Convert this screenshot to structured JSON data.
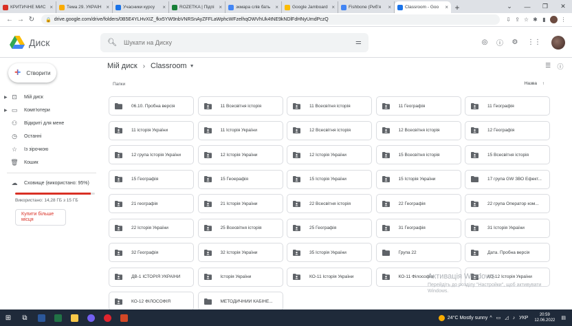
{
  "browser": {
    "tabs": [
      {
        "label": "КРИТИЧНЕ МИС",
        "color": "#d93025"
      },
      {
        "label": "Тема 29. УКРАЇН",
        "color": "#f9ab00"
      },
      {
        "label": "Учасники курсу",
        "color": "#1a73e8"
      },
      {
        "label": "ROZETKA | Підпі",
        "color": "#188038"
      },
      {
        "label": "зкмара слів бать",
        "color": "#4285f4"
      },
      {
        "label": "Google Jamboard",
        "color": "#fbbc04"
      },
      {
        "label": "Fishbone (Риб'я",
        "color": "#4285f4"
      },
      {
        "label": "Classroom - Goo",
        "color": "#1a73e8"
      }
    ],
    "url": "drive.google.com/drive/folders/0B5E4YLHvXIZ_fkx5YW9nbVNRSnAyZFFLaWphcWFzelhqOWVhUk4tNE9kNDlFdHNyUmdPczQ"
  },
  "header": {
    "brand": "Диск",
    "search_placeholder": "Шукати на Диску"
  },
  "sidebar": {
    "new_label": "Створити",
    "items": [
      {
        "label": "Мій диск",
        "icon": "drive-icon"
      },
      {
        "label": "Комп'ютери",
        "icon": "computer-icon"
      },
      {
        "label": "Відкриті для мене",
        "icon": "people-icon"
      },
      {
        "label": "Останні",
        "icon": "clock-icon"
      },
      {
        "label": "Із зірочкою",
        "icon": "star-icon"
      },
      {
        "label": "Кошик",
        "icon": "trash-icon"
      }
    ],
    "storage_label": "Сховище (використано: 95%)",
    "storage_percent": 95,
    "storage_text": "Використано: 14,28 ГБ з 15 ГБ",
    "buy_label": "Купити більше місця"
  },
  "main": {
    "breadcrumb": {
      "root": "Мій диск",
      "current": "Classroom"
    },
    "section_label": "Папки",
    "sort_label": "Назва",
    "folders": [
      {
        "label": "06.10. Пробна версія",
        "shared": false
      },
      {
        "label": "11 Всесвітня історія",
        "shared": true
      },
      {
        "label": "11 Всесвітня історія",
        "shared": true
      },
      {
        "label": "11 Географія",
        "shared": true
      },
      {
        "label": "11 Географія",
        "shared": true
      },
      {
        "label": "11 історія України",
        "shared": true
      },
      {
        "label": "11 Історія України",
        "shared": true
      },
      {
        "label": "12 Всесвітня історія",
        "shared": true
      },
      {
        "label": "12 Всесвітня історія",
        "shared": true
      },
      {
        "label": "12 Географія",
        "shared": true
      },
      {
        "label": "12 група Історія України",
        "shared": true
      },
      {
        "label": "12 Історія України",
        "shared": true
      },
      {
        "label": "12 Історія України",
        "shared": true
      },
      {
        "label": "15 Всесвітня історія",
        "shared": true
      },
      {
        "label": "15 Всесвітня історія",
        "shared": true
      },
      {
        "label": "15 Географія",
        "shared": true
      },
      {
        "label": "15 Геоерафія",
        "shared": true
      },
      {
        "label": "15 Історія України",
        "shared": true
      },
      {
        "label": "15 Історія України",
        "shared": true
      },
      {
        "label": "17 група GW ЗВО Ефект...",
        "shared": false
      },
      {
        "label": "21 географія",
        "shared": true
      },
      {
        "label": "21 Історія України",
        "shared": true
      },
      {
        "label": "22 Всесвітня історія",
        "shared": true
      },
      {
        "label": "22 Географія",
        "shared": true
      },
      {
        "label": "22 група Оператор ком...",
        "shared": true
      },
      {
        "label": "22 Історія України",
        "shared": true
      },
      {
        "label": "25 Всесвітня історія",
        "shared": true
      },
      {
        "label": "25 Географія",
        "shared": true
      },
      {
        "label": "31 Географія",
        "shared": true
      },
      {
        "label": "31 Історія України",
        "shared": true
      },
      {
        "label": "32 Географія",
        "shared": true
      },
      {
        "label": "32 Історія України",
        "shared": true
      },
      {
        "label": "35 Історія України",
        "shared": true
      },
      {
        "label": "Група 22",
        "shared": false
      },
      {
        "label": "Дата. Пробна версія",
        "shared": true
      },
      {
        "label": "ДВ-1 ІСТОРІЯ УКРАЇНИ",
        "shared": true
      },
      {
        "label": "Історія України",
        "shared": true
      },
      {
        "label": "КО-11 Історія України",
        "shared": true
      },
      {
        "label": "КО-11 Філософія",
        "shared": true
      },
      {
        "label": "КО-12 Історія України",
        "shared": true
      },
      {
        "label": "КО-12 ФІЛОСОФІЯ",
        "shared": true
      },
      {
        "label": "МЕТОДИЧНИЙ КАБІНЕ...",
        "shared": false
      }
    ]
  },
  "watermark": {
    "line1": "Активація Windows",
    "line2": "Перейдіть до розділу \"Настройки\", щоб активувати Windows."
  },
  "taskbar": {
    "weather": "24°C  Mostly sunny",
    "lang": "УКР",
    "time": "20:59",
    "date": "12.06.2022"
  }
}
